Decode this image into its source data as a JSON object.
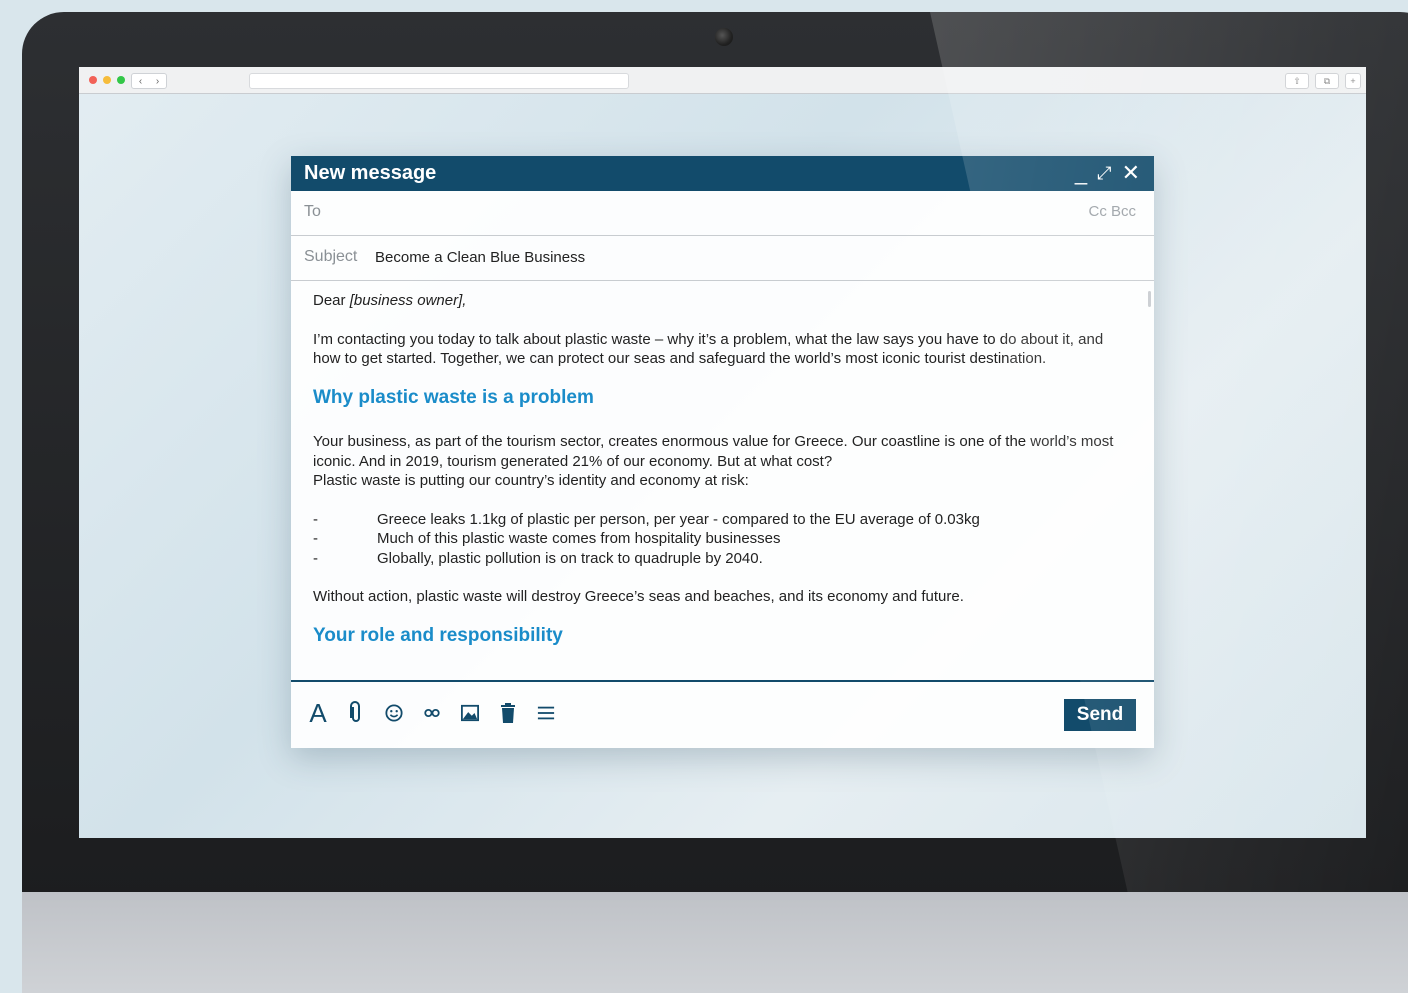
{
  "compose": {
    "title": "New message",
    "to_label": "To",
    "cc_bcc": "Cc Bcc",
    "subject_label": "Subject",
    "subject_value": "Become a Clean Blue Business",
    "body": {
      "greeting_prefix": "Dear ",
      "greeting_placeholder": "[business owner],",
      "intro": "I’m contacting you today to talk about plastic waste – why it’s a problem, what the law says you have to do about it, and how to get started. Together, we can protect our seas and safeguard the world’s most iconic tourist destination.",
      "heading1": "Why plastic waste is a problem",
      "para1_line1": "Your business, as part of the tourism sector, creates enormous value for Greece. Our coastline is one of the world’s most iconic. And in 2019, tourism generated 21% of our economy. But at what cost?",
      "para1_line2": "Plastic waste is putting our country’s identity and economy at risk:",
      "bullets": [
        {
          "dash": "-",
          "text": "Greece leaks 1.1kg of plastic per person, per year - compared to the EU average of 0.03kg"
        },
        {
          "dash": "-",
          "text": "Much of this plastic waste comes from hospitality businesses"
        },
        {
          "dash": "-",
          "text": "Globally, plastic pollution is on track to quadruple by 2040."
        }
      ],
      "para2": "Without action, plastic waste will destroy Greece’s seas and beaches, and its economy and future.",
      "heading2": "Your role and responsibility"
    },
    "send_label": "Send",
    "toolbar_icons": [
      "format-text-icon",
      "attachment-icon",
      "emoji-icon",
      "link-icon",
      "image-icon",
      "trash-icon",
      "more-options-icon"
    ]
  },
  "colors": {
    "header": "#124b6b",
    "heading": "#1a8cc9"
  }
}
